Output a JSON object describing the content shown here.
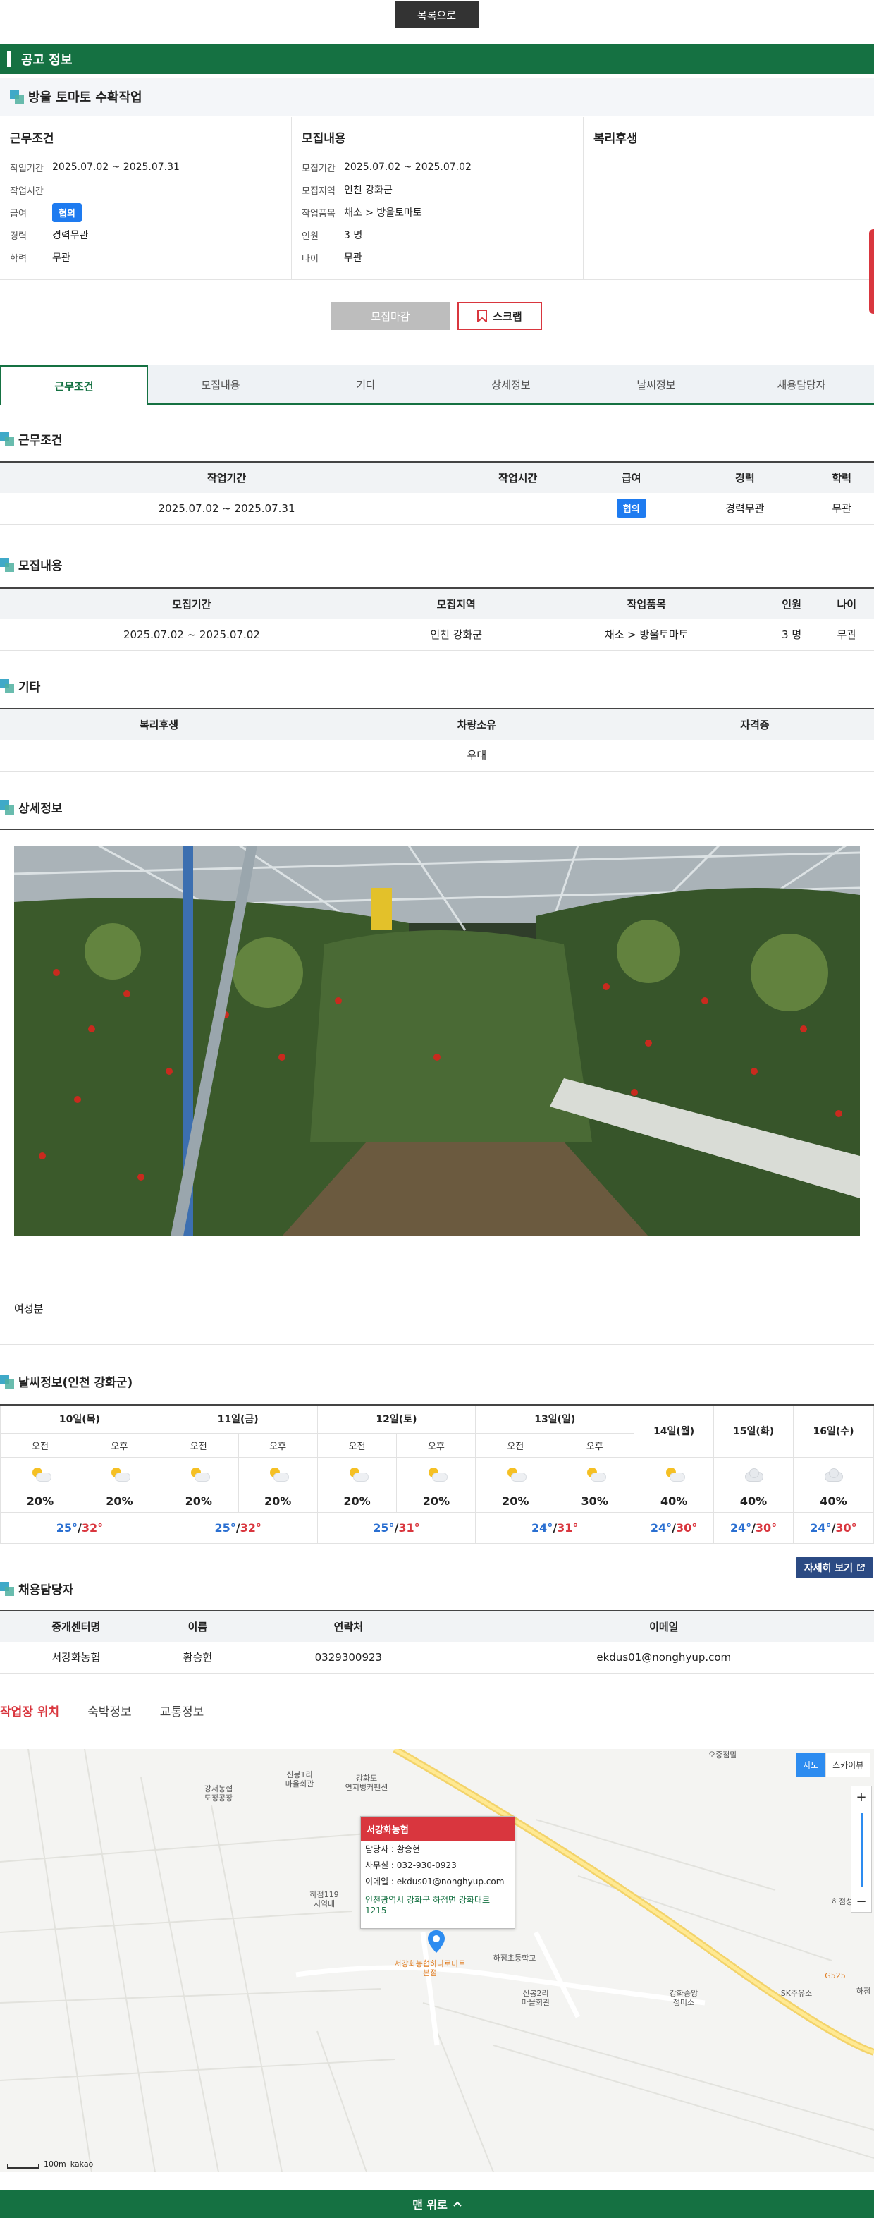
{
  "header": {
    "list_button": "목록으로",
    "section_title": "공고 정보"
  },
  "job": {
    "title": "방울 토마토 수확작업"
  },
  "summary": {
    "work": {
      "title": "근무조건",
      "rows": [
        {
          "k": "작업기간",
          "v": "2025.07.02 ~ 2025.07.31"
        },
        {
          "k": "작업시간",
          "v": ""
        },
        {
          "k": "급여",
          "v": "협의",
          "badge": true
        },
        {
          "k": "경력",
          "v": "경력무관"
        },
        {
          "k": "학력",
          "v": "무관"
        }
      ]
    },
    "recruit": {
      "title": "모집내용",
      "rows": [
        {
          "k": "모집기간",
          "v": "2025.07.02 ~ 2025.07.02"
        },
        {
          "k": "모집지역",
          "v": "인천 강화군"
        },
        {
          "k": "작업품목",
          "v": "채소 > 방울토마토"
        },
        {
          "k": "인원",
          "v": "3 명"
        },
        {
          "k": "나이",
          "v": "무관"
        }
      ]
    },
    "welfare": {
      "title": "복리후생"
    }
  },
  "actions": {
    "closed": "모집마감",
    "scrap": "스크랩"
  },
  "tabs": [
    "근무조건",
    "모집내용",
    "기타",
    "상세정보",
    "날씨정보",
    "채용담당자"
  ],
  "sections": {
    "work": {
      "title": "근무조건",
      "headers": [
        "작업기간",
        "작업시간",
        "급여",
        "경력",
        "학력"
      ],
      "row": [
        "2025.07.02 ~ 2025.07.31",
        "",
        "협의",
        "경력무관",
        "무관"
      ]
    },
    "recruit": {
      "title": "모집내용",
      "headers": [
        "모집기간",
        "모집지역",
        "작업품목",
        "인원",
        "나이"
      ],
      "row": [
        "2025.07.02 ~ 2025.07.02",
        "인천 강화군",
        "채소 > 방울토마토",
        "3 명",
        "무관"
      ]
    },
    "etc": {
      "title": "기타",
      "headers": [
        "복리후생",
        "차량소유",
        "자격증"
      ],
      "row": [
        "",
        "우대",
        ""
      ]
    },
    "detail": {
      "title": "상세정보",
      "text": "여성분"
    },
    "weather": {
      "title": "날씨정보(인천 강화군)",
      "more": "자세히 보기",
      "am": "오전",
      "pm": "오후",
      "split_days": [
        {
          "day": "10일(목)",
          "am": {
            "icon": "partly-cloudy-icon",
            "pop": "20%"
          },
          "pm": {
            "icon": "partly-cloudy-icon",
            "pop": "20%"
          },
          "lo": "25°",
          "hi": "32°"
        },
        {
          "day": "11일(금)",
          "am": {
            "icon": "partly-cloudy-icon",
            "pop": "20%"
          },
          "pm": {
            "icon": "partly-cloudy-icon",
            "pop": "20%"
          },
          "lo": "25°",
          "hi": "32°"
        },
        {
          "day": "12일(토)",
          "am": {
            "icon": "partly-cloudy-icon",
            "pop": "20%"
          },
          "pm": {
            "icon": "partly-cloudy-icon",
            "pop": "20%"
          },
          "lo": "25°",
          "hi": "31°"
        },
        {
          "day": "13일(일)",
          "am": {
            "icon": "partly-cloudy-icon",
            "pop": "20%"
          },
          "pm": {
            "icon": "partly-cloudy-icon",
            "pop": "30%"
          },
          "lo": "24°",
          "hi": "31°"
        }
      ],
      "single_days": [
        {
          "day": "14일(월)",
          "icon": "partly-cloudy-icon",
          "pop": "40%",
          "lo": "24°",
          "hi": "30°"
        },
        {
          "day": "15일(화)",
          "icon": "cloudy-icon",
          "pop": "40%",
          "lo": "24°",
          "hi": "30°"
        },
        {
          "day": "16일(수)",
          "icon": "cloudy-icon",
          "pop": "40%",
          "lo": "24°",
          "hi": "30°"
        }
      ]
    },
    "contact": {
      "title": "채용담당자",
      "headers": [
        "중개센터명",
        "이름",
        "연락처",
        "이메일"
      ],
      "row": [
        "서강화농협",
        "황승현",
        "0329300923",
        "ekdus01@nonghyup.com"
      ]
    }
  },
  "location_tabs": [
    "작업장 위치",
    "숙박정보",
    "교통정보"
  ],
  "map": {
    "type_map": "지도",
    "type_sky": "스카이뷰",
    "zoom_in": "+",
    "zoom_out": "−",
    "info": {
      "name": "서강화농협",
      "manager": "담당자 : 황승현",
      "office": "사무실 : 032-930-0923",
      "email": "이메일 : ekdus01@nonghyup.com",
      "address": "인천광역시 강화군 하점면 강화대로 1215"
    },
    "labels": {
      "l1": "오중점말",
      "l2": "강서농협\n도정공장",
      "l3": "신봉1리\n마을회관",
      "l4": "강화도\n연지벙커펜션",
      "l5": "하점119\n지역대",
      "l6": "서강화농협하나로마트\n본점",
      "l7": "하점초등학교",
      "l8": "신봉2리\n마을회관",
      "l9": "강화중앙\n정미소",
      "l10": "SK주유소",
      "l11": "하점성당",
      "l12": "G525",
      "l13": "하점"
    },
    "scale": "100m",
    "brand": "kakao",
    "colors": {
      "marker": "#2d8cf0",
      "header": "#d9363e"
    }
  },
  "footer": {
    "top_button": "맨 위로"
  },
  "colors": {
    "brand_green": "#157142",
    "badge_blue": "#1e7bf0",
    "accent_red": "#d9363e"
  }
}
